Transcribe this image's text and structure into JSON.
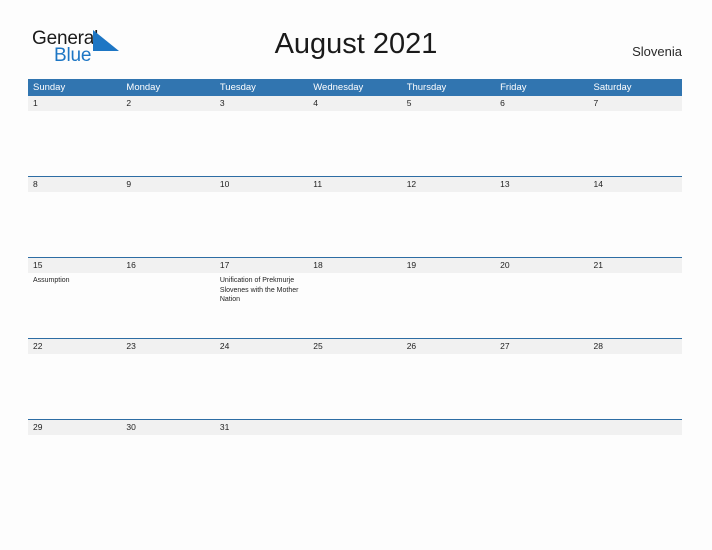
{
  "brand": {
    "name_top": "General",
    "name_bottom": "Blue",
    "sail_icon": "sail-triangle-icon",
    "color_dark": "#1a1a1a",
    "color_blue": "#1d76c4"
  },
  "header": {
    "title": "August 2021",
    "region": "Slovenia"
  },
  "theme": {
    "header_blue": "#3175b0",
    "rule_blue": "#2d6da4",
    "date_band_gray": "#f1f1f1",
    "page_background": "#fdfdfd",
    "text_dark": "#1f1f1f"
  },
  "calendar": {
    "month": "August",
    "year": "2021",
    "weekday_headers": [
      "Sunday",
      "Monday",
      "Tuesday",
      "Wednesday",
      "Thursday",
      "Friday",
      "Saturday"
    ],
    "weeks": [
      {
        "days": [
          {
            "date": "1",
            "event": ""
          },
          {
            "date": "2",
            "event": ""
          },
          {
            "date": "3",
            "event": ""
          },
          {
            "date": "4",
            "event": ""
          },
          {
            "date": "5",
            "event": ""
          },
          {
            "date": "6",
            "event": ""
          },
          {
            "date": "7",
            "event": ""
          }
        ]
      },
      {
        "days": [
          {
            "date": "8",
            "event": ""
          },
          {
            "date": "9",
            "event": ""
          },
          {
            "date": "10",
            "event": ""
          },
          {
            "date": "11",
            "event": ""
          },
          {
            "date": "12",
            "event": ""
          },
          {
            "date": "13",
            "event": ""
          },
          {
            "date": "14",
            "event": ""
          }
        ]
      },
      {
        "days": [
          {
            "date": "15",
            "event": "Assumption"
          },
          {
            "date": "16",
            "event": ""
          },
          {
            "date": "17",
            "event": "Unification of Prekmurje Slovenes with the Mother Nation"
          },
          {
            "date": "18",
            "event": ""
          },
          {
            "date": "19",
            "event": ""
          },
          {
            "date": "20",
            "event": ""
          },
          {
            "date": "21",
            "event": ""
          }
        ]
      },
      {
        "days": [
          {
            "date": "22",
            "event": ""
          },
          {
            "date": "23",
            "event": ""
          },
          {
            "date": "24",
            "event": ""
          },
          {
            "date": "25",
            "event": ""
          },
          {
            "date": "26",
            "event": ""
          },
          {
            "date": "27",
            "event": ""
          },
          {
            "date": "28",
            "event": ""
          }
        ]
      },
      {
        "days": [
          {
            "date": "29",
            "event": ""
          },
          {
            "date": "30",
            "event": ""
          },
          {
            "date": "31",
            "event": ""
          },
          {
            "date": "",
            "event": ""
          },
          {
            "date": "",
            "event": ""
          },
          {
            "date": "",
            "event": ""
          },
          {
            "date": "",
            "event": ""
          }
        ]
      }
    ]
  }
}
